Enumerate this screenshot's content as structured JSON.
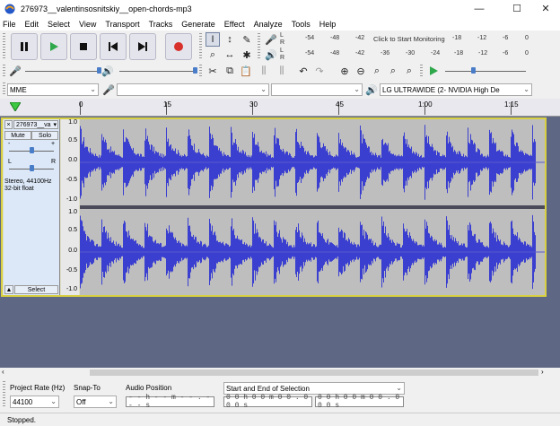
{
  "window": {
    "title": "276973__valentinsosnitskiy__open-chords-mp3"
  },
  "menu": [
    "File",
    "Edit",
    "Select",
    "View",
    "Transport",
    "Tracks",
    "Generate",
    "Effect",
    "Analyze",
    "Tools",
    "Help"
  ],
  "transport": {
    "pause_icon": "pause-icon",
    "play_icon": "play-icon",
    "stop_icon": "stop-icon",
    "skip_start_icon": "skip-to-start-icon",
    "skip_end_icon": "skip-to-end-icon",
    "record_icon": "record-icon"
  },
  "meters": {
    "record_scale": [
      "-54",
      "-48",
      "-42",
      "-18",
      "-12",
      "-6",
      "0"
    ],
    "record_prompt": "Click to Start Monitoring",
    "playback_scale": [
      "-54",
      "-48",
      "-42",
      "-36",
      "-30",
      "-24",
      "-18",
      "-12",
      "-6",
      "0"
    ],
    "channel_l": "L",
    "channel_r": "R"
  },
  "device": {
    "host": "MME",
    "output": "LG ULTRAWIDE (2- NVIDIA High De"
  },
  "timeline": {
    "labels": [
      "0",
      "15",
      "30",
      "45",
      "1:00",
      "1:15"
    ]
  },
  "track": {
    "name": "276973__va",
    "mute": "Mute",
    "solo": "Solo",
    "minus": "-",
    "plus": "+",
    "pan_l": "L",
    "pan_r": "R",
    "info_line1": "Stereo, 44100Hz",
    "info_line2": "32-bit float",
    "select": "Select",
    "collapse": "▲",
    "close": "×",
    "menu_arrow": "▾",
    "ruler": [
      "1.0",
      "0.5",
      "0.0",
      "-0.5",
      "-1.0"
    ]
  },
  "bottom": {
    "project_rate_label": "Project Rate (Hz)",
    "project_rate_value": "44100",
    "snap_label": "Snap-To",
    "snap_value": "Off",
    "audio_position_label": "Audio Position",
    "audio_position_value": "- - h - - m - - . - - - s",
    "selection_label": "Start and End of Selection",
    "sel_start": "0 0 h 0 0 m 0 0 . 0 0 0 s",
    "sel_end": "0 0 h 0 0 m 0 0 . 0 0 0 s"
  },
  "status": "Stopped.",
  "colors": {
    "wave": "#3b3fd0",
    "wave_bg": "#bebebe",
    "track_border": "#d8d040",
    "record": "#d8302a",
    "play": "#2ea84a"
  }
}
